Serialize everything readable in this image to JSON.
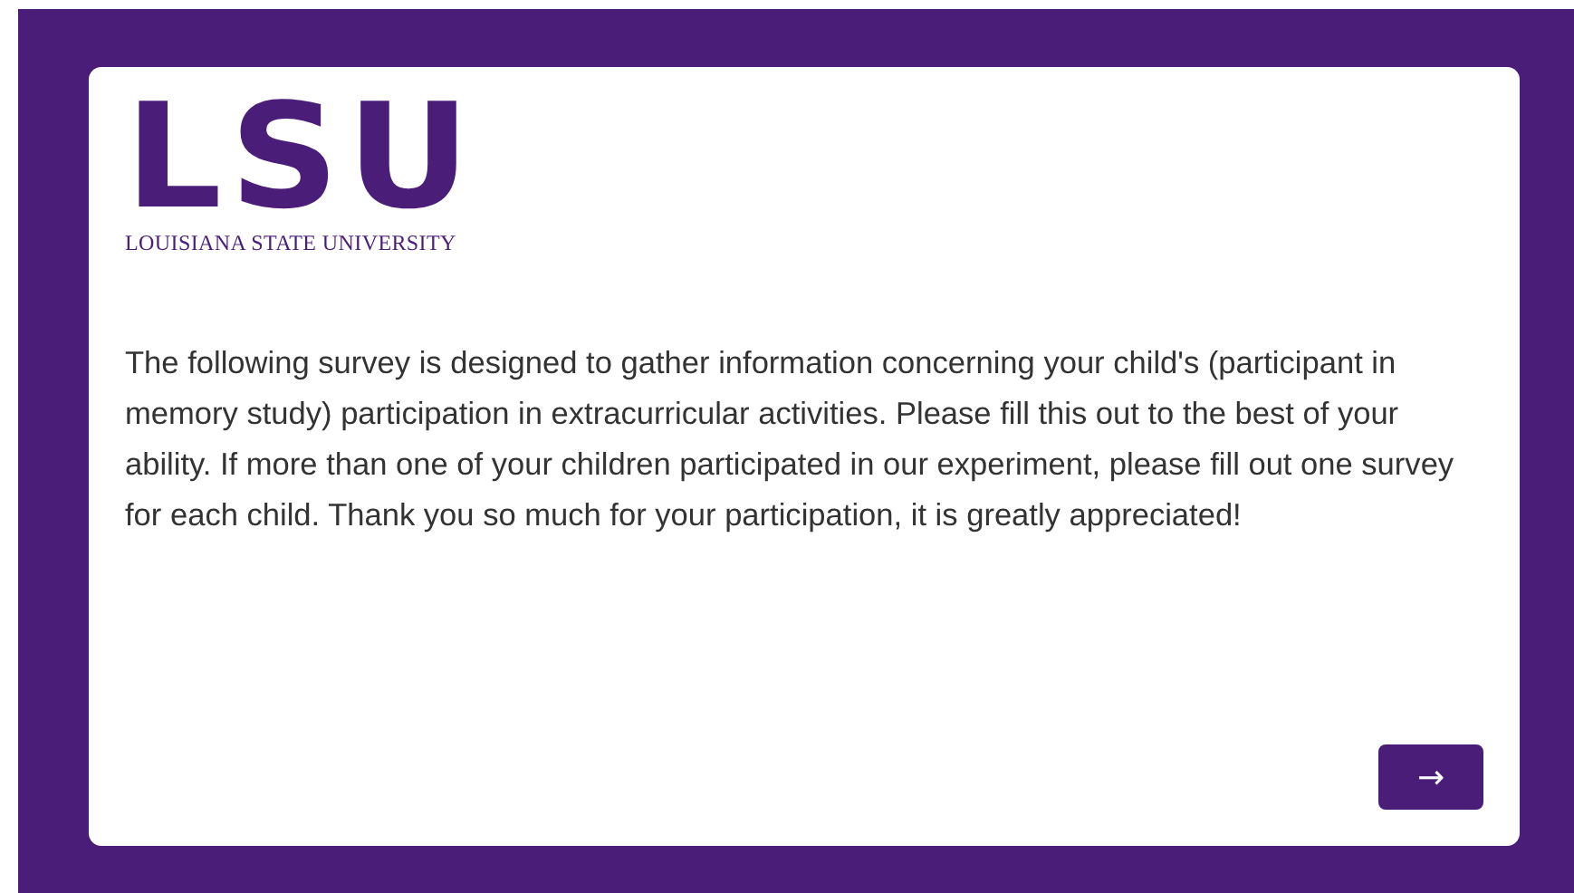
{
  "logo": {
    "mark": "LSU",
    "wordmark": "LOUISIANA STATE UNIVERSITY"
  },
  "intro": "The following survey is designed to gather information concerning your child's (participant in memory study) participation in extracurricular activities. Please fill this out to the best of your ability. If more than one of your children participated in our experiment, please fill out one survey for each child. Thank you so much for your participation, it is greatly appreciated!",
  "next_button": "→"
}
